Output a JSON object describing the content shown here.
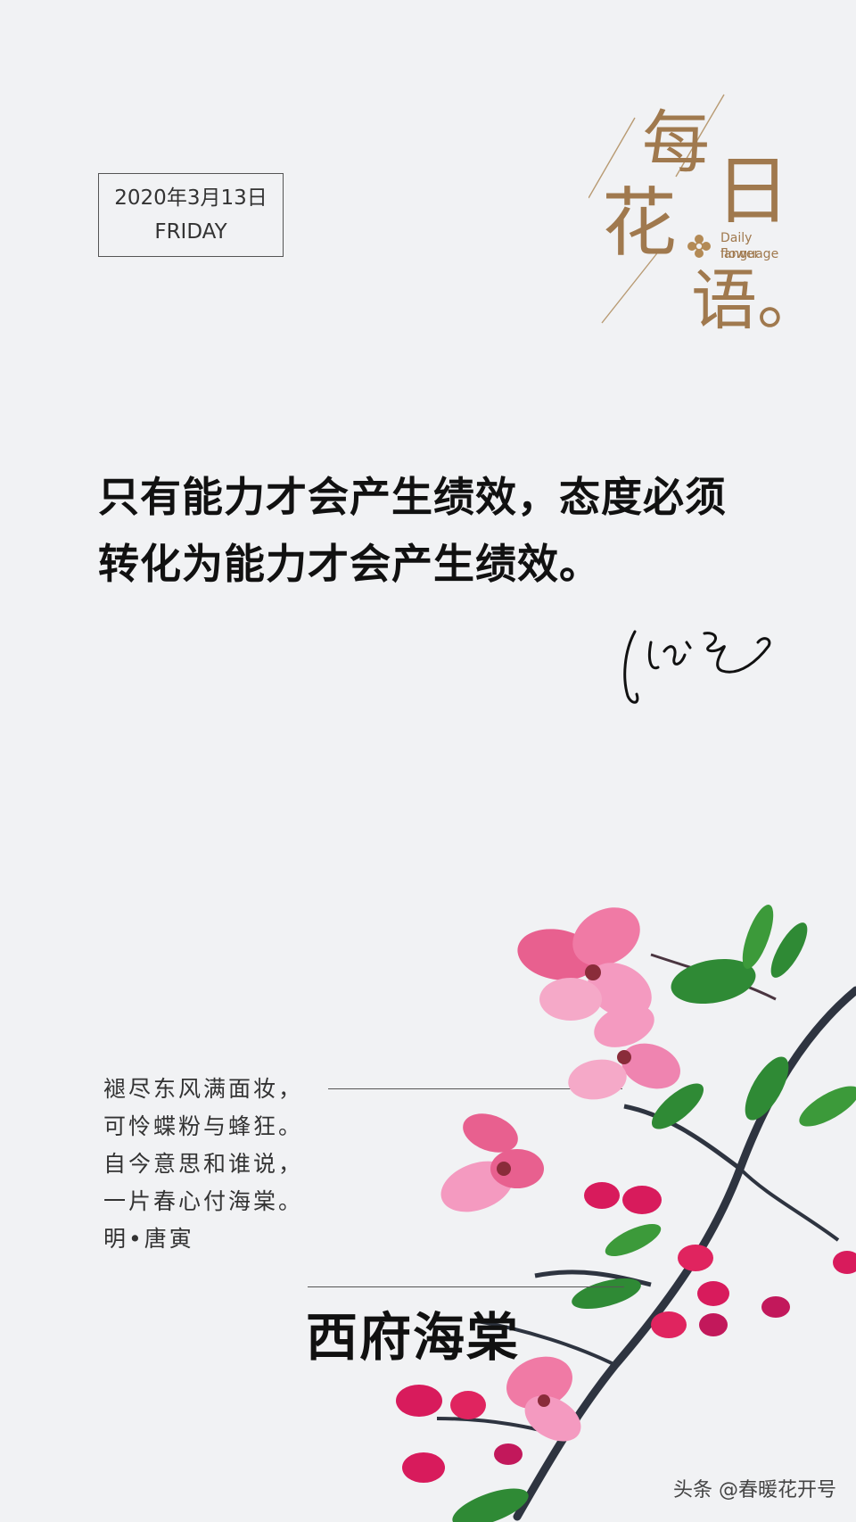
{
  "date_box": {
    "date": "2020年3月13日",
    "weekday": "FRIDAY"
  },
  "logo": {
    "char1": "每",
    "char2": "日",
    "char3": "花",
    "char4": "语。",
    "english_line1": "Daily flower",
    "english_line2": "language",
    "accent_color": "#a0794e"
  },
  "quote": {
    "line1": "只有能力才会产生绩效，态度必须",
    "line2": "转化为能力才会产生绩效。"
  },
  "poem": {
    "lines": [
      "褪尽东风满面妆，",
      "可怜蝶粉与蜂狂。",
      "自今意思和谁说，",
      "一片春心付海棠。",
      "明•唐寅"
    ]
  },
  "flower_name": "西府海棠",
  "watermark": "头条 @春暖花开号"
}
